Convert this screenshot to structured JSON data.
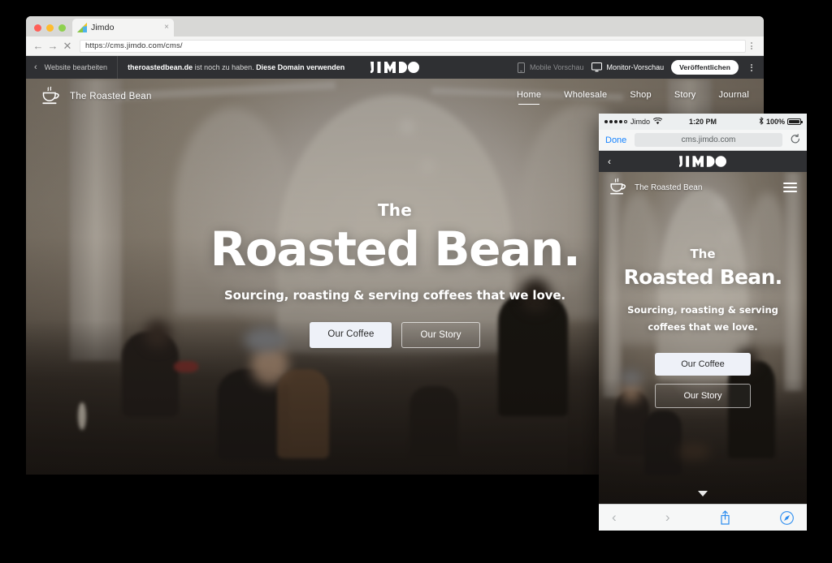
{
  "browser": {
    "tab": {
      "title": "Jimdo",
      "close_label": "×",
      "favicon": "jimdo-favicon"
    },
    "traffic_lights": [
      "close-red",
      "minimize-yellow",
      "maximize-green"
    ],
    "nav": {
      "back": "←",
      "forward": "→",
      "stop": "✕"
    },
    "url": "https://cms.jimdo.com/cms/",
    "menu": "kebab-menu"
  },
  "editor_bar": {
    "back_chevron": "‹",
    "edit_label": "Website bearbeiten",
    "domain_name": "theroastedbean.de",
    "domain_text": " ist noch zu haben. ",
    "domain_cta": "Diese Domain verwenden",
    "logo": "JIMDO",
    "mobile_preview": "Mobile Vorschau",
    "monitor_preview": "Monitor-Vorschau",
    "publish": "Veröffentlichen",
    "overflow": "kebab-menu"
  },
  "site": {
    "brand": "The Roasted Bean",
    "brand_icon": "coffee-cup-icon",
    "nav": [
      {
        "label": "Home",
        "active": true
      },
      {
        "label": "Wholesale",
        "active": false
      },
      {
        "label": "Shop",
        "active": false
      },
      {
        "label": "Story",
        "active": false
      },
      {
        "label": "Journal",
        "active": false
      }
    ],
    "hero": {
      "kicker": "The",
      "title": "Roasted Bean.",
      "subtitle": "Sourcing, roasting & serving coffees that we love.",
      "button_primary": "Our Coffee",
      "button_secondary": "Our Story",
      "scroll_icon": "chevron-down-icon"
    }
  },
  "mobile": {
    "status": {
      "signal_dots": 5,
      "signal_filled": 4,
      "carrier": "Jimdo",
      "wifi_icon": "wifi-icon",
      "time": "1:20 PM",
      "bluetooth_icon": "bluetooth-icon",
      "battery_percent": "100%",
      "battery_icon": "battery-full-icon"
    },
    "url_bar": {
      "done": "Done",
      "url": "cms.jimdo.com",
      "reload_icon": "reload-icon"
    },
    "jimdo_bar": {
      "back_chevron": "‹",
      "logo": "JIMDO"
    },
    "site": {
      "brand": "The Roasted Bean",
      "brand_icon": "coffee-cup-icon",
      "menu_icon": "hamburger-icon",
      "hero": {
        "kicker": "The",
        "title": "Roasted Bean.",
        "subtitle_line1": "Sourcing, roasting & serving",
        "subtitle_line2": "coffees that we love.",
        "button_primary": "Our Coffee",
        "button_secondary": "Our Story",
        "scroll_icon": "chevron-down-icon"
      }
    },
    "toolbar": {
      "back_icon": "‹",
      "forward_icon": "›",
      "share_icon": "share-icon",
      "safari_icon": "safari-compass-icon"
    }
  },
  "colors": {
    "page_background": "#000000",
    "editor_bar": "#2f3033",
    "ios_blue": "#1784ff",
    "publish_pill": "#ffffff",
    "button_primary_bg": "#eef1f8"
  }
}
